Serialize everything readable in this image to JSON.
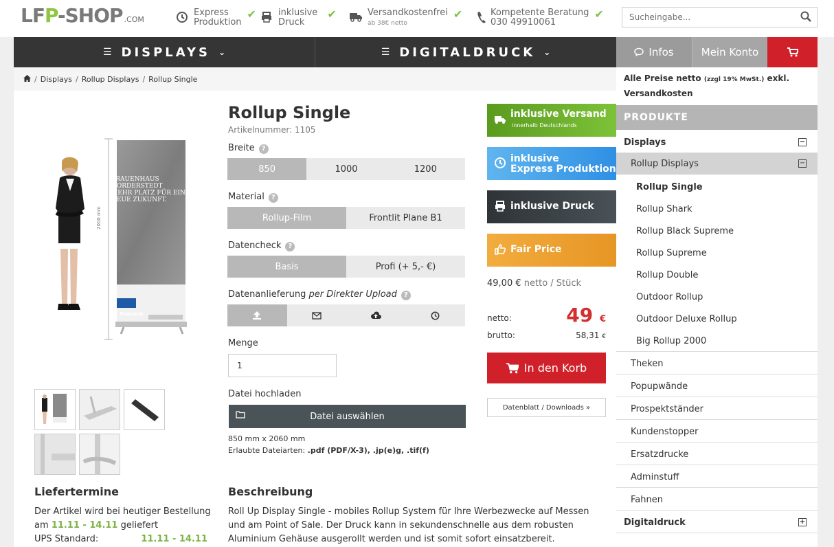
{
  "header": {
    "logo": {
      "part1": "LF",
      "part2": "P",
      "part3": "-SHOP",
      "suffix": ".COM"
    },
    "usps": [
      {
        "icon": "clock-icon",
        "line1": "Express",
        "line2": "Produktion",
        "sub": ""
      },
      {
        "icon": "printer-icon",
        "line1": "inklusive",
        "line2": "Druck",
        "sub": ""
      },
      {
        "icon": "truck-icon",
        "line1": "Versandkostenfrei",
        "line2": "",
        "sub": "ab 38€ netto"
      },
      {
        "icon": "phone-icon",
        "line1": "Kompetente Beratung",
        "line2": "030 49910061",
        "sub": ""
      }
    ],
    "search_placeholder": "Sucheingabe..."
  },
  "nav": {
    "displays": "DISPLAYS",
    "digitaldruck": "DIGITALDRUCK",
    "infos": "Infos",
    "konto": "Mein Konto"
  },
  "breadcrumb": {
    "items": [
      "Displays",
      "Rollup Displays",
      "Rollup Single"
    ]
  },
  "product": {
    "title": "Rollup Single",
    "artnr": "Artikelnummer: 1105",
    "image_text": {
      "line1": "FRAUENHAUS",
      "line2": "NORDERSTEDT",
      "line3": "MEHR PLATZ FÜR EINE",
      "line4": "NEUE ZUKUNFT.",
      "height": "2000 mm",
      "brand": "Diakonie"
    },
    "breite_label": "Breite",
    "breite_options": [
      "850",
      "1000",
      "1200"
    ],
    "material_label": "Material",
    "material_options": [
      "Rollup-Film",
      "Frontlit Plane B1"
    ],
    "datencheck_label": "Datencheck",
    "datencheck_options": [
      "Basis",
      "Profi (+ 5,- €)"
    ],
    "anlieferung_label": "Datenanlieferung",
    "anlieferung_value": "per Direkter Upload",
    "menge_label": "Menge",
    "menge_value": "1",
    "datei_label": "Datei hochladen",
    "datei_button": "Datei auswählen",
    "size_info": "850 mm x 2060 mm",
    "filetypes_label": "Erlaubte Dateiarten:",
    "filetypes_value": ".pdf (PDF/X-3), .jp(e)g, .tif(f)"
  },
  "badges": [
    {
      "title": "inklusive Versand",
      "sub": "innerhalb Deutschlands",
      "color": "#6fb12b"
    },
    {
      "title": "inklusive",
      "title2": "Express Produktion",
      "color": "#3aa0e8"
    },
    {
      "title": "inklusive Druck",
      "color": "#3c4247"
    },
    {
      "title": "Fair Price",
      "color": "#f0a531"
    }
  ],
  "price": {
    "unit_price": "49,00 €",
    "unit_suffix": "netto / Stück",
    "netto_label": "netto:",
    "netto_value": "49",
    "currency": "€",
    "brutto_label": "brutto:",
    "brutto_value": "58,31",
    "cart_button": "In den Korb",
    "datasheet_button": "Datenblatt / Downloads »"
  },
  "delivery": {
    "heading": "Liefertermine",
    "text1": "Der Artikel wird bei heutiger Bestellung",
    "text2a": "am",
    "dates": "11.11 - 14.11",
    "text2b": "geliefert",
    "ups": "UPS Standard:",
    "ups_dates": "11.11 - 14.11"
  },
  "description": {
    "heading": "Beschreibung",
    "line1": "Roll Up Display Single - mobiles Rollup System für Ihre Werbezwecke auf Messen",
    "line2": "und am Point of Sale. Der Druck kann in sekundenschnelle aus dem robusten",
    "line3": "Aluminium Gehäuse ausgerollt werden und ist somit sofort einsatzbereit."
  },
  "sidebar": {
    "notice_bold": "Alle Preise netto",
    "notice_small": "(zzgl 19% MwSt.)",
    "notice_rest": "exkl.",
    "notice_line2": "Versandkosten",
    "heading": "PRODUKTE",
    "displays": "Displays",
    "rollup_displays": "Rollup Displays",
    "rollups": [
      "Rollup Single",
      "Rollup Shark",
      "Rollup Black Supreme",
      "Rollup Supreme",
      "Rollup Double",
      "Outdoor Rollup",
      "Outdoor Deluxe Rollup",
      "Big Rollup 2000"
    ],
    "categories": [
      "Theken",
      "Popupwände",
      "Prospektständer",
      "Kundenstopper",
      "Ersatzdrucke",
      "Adminstuff",
      "Fahnen"
    ],
    "digitaldruck": "Digitaldruck"
  },
  "colors": {
    "accent_red": "#d0202a",
    "nav_dark": "#353535",
    "green": "#7cc142"
  }
}
